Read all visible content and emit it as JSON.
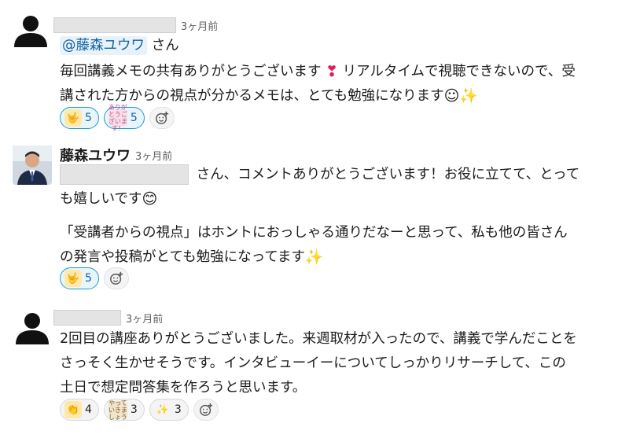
{
  "comments": [
    {
      "time": "3ヶ月前",
      "mention": "@藤森ユウワ",
      "mention_suffix": " さん",
      "line1": "毎回講義メモの共有ありがとうございます",
      "line1b": "リアルタイムで視聴できないので、受",
      "line2": "講された方からの視点が分かるメモは、とても勉強になります",
      "reactions": [
        {
          "icon": "love-you-gesture",
          "glyph": "🤟",
          "count": "5"
        },
        {
          "icon": "arigatou-gozaimasu-sticker",
          "glyph": "ありがとうございます！",
          "count": "5"
        }
      ]
    },
    {
      "name": "藤森ユウワ",
      "time": "3ヶ月前",
      "line1_suffix": "さん、コメントありがとうございます！お役に立てて、とって",
      "line2": "も嬉しいです",
      "para2_line1": "「受講者からの視点」はホントにおっしゃる通りだなーと思って、私も他の皆さん",
      "para2_line2": "の発言や投稿がとても勉強になってます",
      "reactions": [
        {
          "icon": "love-you-gesture",
          "glyph": "🤟",
          "count": "5"
        }
      ]
    },
    {
      "time": "3ヶ月前",
      "line1": "2回目の講座ありがとうございました。来週取材が入ったので、講義で学んだことを",
      "line2": "さっそく生かせそうです。インタビューイーについてしっかりリサーチして、この",
      "line3": "土日で想定問答集を作ろうと思います。",
      "reactions": [
        {
          "icon": "clapping-hands",
          "glyph": "👏",
          "count": "4"
        },
        {
          "icon": "yatteikimashou-sticker",
          "glyph": "やっていきましょう",
          "count": "3"
        },
        {
          "icon": "sparkles",
          "glyph": "✨",
          "count": "3"
        }
      ]
    }
  ],
  "emoji": {
    "heart": "❣",
    "smile": "☺",
    "sparkles": "✨",
    "grin": "😊"
  },
  "colors": {
    "mention_bg": "#e8f2fa",
    "mention_text": "#1264a3",
    "reaction_active_border": "#1d9bd1",
    "timestamp": "#616061"
  }
}
